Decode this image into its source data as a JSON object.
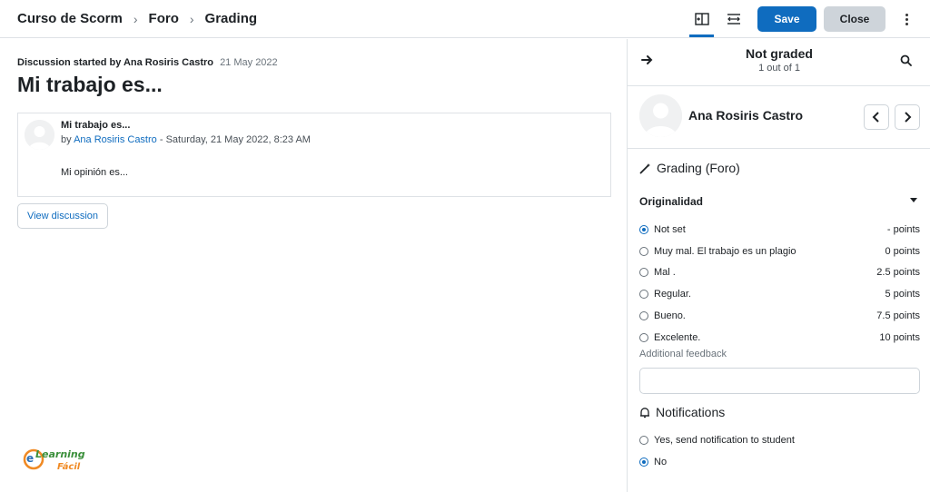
{
  "breadcrumb": {
    "course": "Curso de Scorm",
    "forum": "Foro",
    "current": "Grading"
  },
  "toolbar": {
    "save_label": "Save",
    "close_label": "Close"
  },
  "discussion": {
    "started_by_label": "Discussion started by Ana Rosiris Castro",
    "date": "21 May 2022",
    "title": "Mi trabajo es...",
    "post": {
      "subject": "Mi trabajo es...",
      "by_prefix": "by",
      "author": "Ana Rosiris Castro",
      "timestamp": "- Saturday, 21 May 2022, 8:23 AM",
      "body": "Mi opinión es..."
    },
    "view_label": "View discussion"
  },
  "logo": {
    "line1": "eLearning",
    "line2": "Fácil"
  },
  "grader": {
    "status": "Not graded",
    "count": "1 out of 1",
    "user_name": "Ana Rosiris Castro",
    "grading_heading": "Grading (Foro)",
    "criterion": "Originalidad",
    "levels": [
      {
        "label": "Not set",
        "points": "- points",
        "selected": true
      },
      {
        "label": "Muy mal. El trabajo es un plagio",
        "points": "0 points",
        "selected": false
      },
      {
        "label": "Mal .",
        "points": "2.5 points",
        "selected": false
      },
      {
        "label": "Regular.",
        "points": "5 points",
        "selected": false
      },
      {
        "label": "Bueno.",
        "points": "7.5 points",
        "selected": false
      },
      {
        "label": "Excelente.",
        "points": "10 points",
        "selected": false
      }
    ],
    "feedback_label": "Additional feedback",
    "feedback_value": "",
    "notifications_heading": "Notifications",
    "notify_yes": "Yes, send notification to student",
    "notify_no": "No",
    "notify_selected": "No"
  },
  "colors": {
    "primary": "#0f6cbf",
    "secondary": "#ced4da",
    "border": "#dee2e6"
  }
}
